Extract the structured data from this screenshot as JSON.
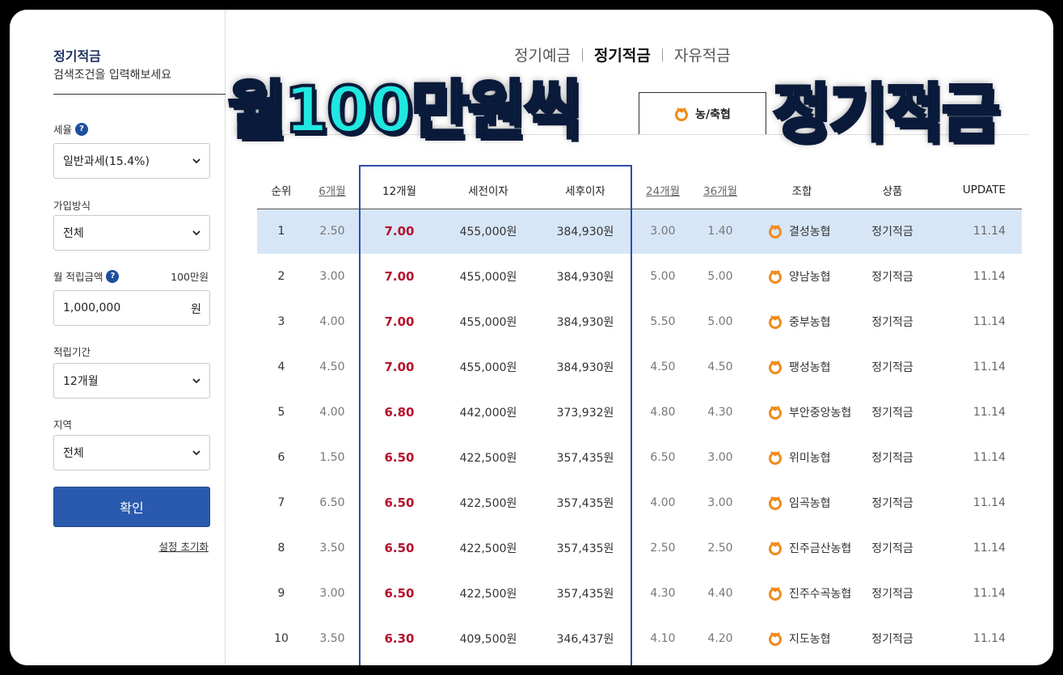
{
  "sidebar": {
    "title": "정기적금",
    "subtitle": "검색조건을 입력해보세요",
    "tax_label": "세율",
    "tax_value": "일반과세(15.4%)",
    "join_label": "가입방식",
    "join_value": "전체",
    "amount_label": "월 적립금액",
    "amount_hint": "100만원",
    "amount_value": "1,000,000",
    "amount_unit": "원",
    "period_label": "적립기간",
    "period_value": "12개월",
    "region_label": "지역",
    "region_value": "전체",
    "confirm_label": "확인",
    "reset_label": "설정 초기화"
  },
  "top_tabs": [
    "정기예금",
    "정기적금",
    "자유적금"
  ],
  "active_tab": "정기적금",
  "sub_tab": "농/축협",
  "overlay": {
    "left": "월100만원씩",
    "right": "정기적금"
  },
  "table": {
    "headers": [
      "순위",
      "6개월",
      "12개월",
      "세전이자",
      "세후이자",
      "24개월",
      "36개월",
      "조합",
      "상품",
      "UPDATE"
    ],
    "rows": [
      [
        "1",
        "2.50",
        "7.00",
        "455,000원",
        "384,930원",
        "3.00",
        "1.40",
        "결성농협",
        "정기적금",
        "11.14"
      ],
      [
        "2",
        "3.00",
        "7.00",
        "455,000원",
        "384,930원",
        "5.00",
        "5.00",
        "양남농협",
        "정기적금",
        "11.14"
      ],
      [
        "3",
        "4.00",
        "7.00",
        "455,000원",
        "384,930원",
        "5.50",
        "5.00",
        "중부농협",
        "정기적금",
        "11.14"
      ],
      [
        "4",
        "4.50",
        "7.00",
        "455,000원",
        "384,930원",
        "4.50",
        "4.50",
        "팽성농협",
        "정기적금",
        "11.14"
      ],
      [
        "5",
        "4.00",
        "6.80",
        "442,000원",
        "373,932원",
        "4.80",
        "4.30",
        "부안중앙농협",
        "정기적금",
        "11.14"
      ],
      [
        "6",
        "1.50",
        "6.50",
        "422,500원",
        "357,435원",
        "6.50",
        "3.00",
        "위미농협",
        "정기적금",
        "11.14"
      ],
      [
        "7",
        "6.50",
        "6.50",
        "422,500원",
        "357,435원",
        "4.00",
        "3.00",
        "임곡농협",
        "정기적금",
        "11.14"
      ],
      [
        "8",
        "3.50",
        "6.50",
        "422,500원",
        "357,435원",
        "2.50",
        "2.50",
        "진주금산농협",
        "정기적금",
        "11.14"
      ],
      [
        "9",
        "3.00",
        "6.50",
        "422,500원",
        "357,435원",
        "4.30",
        "4.40",
        "진주수곡농협",
        "정기적금",
        "11.14"
      ],
      [
        "10",
        "3.50",
        "6.30",
        "409,500원",
        "346,437원",
        "4.10",
        "4.20",
        "지도농협",
        "정기적금",
        "11.14"
      ]
    ]
  },
  "colors": {
    "accent": "#2a5aae",
    "rate": "#b5122c",
    "highlight": "#d7e6f7",
    "overlay": "#20e8e0",
    "medal": "#f08a1c"
  }
}
